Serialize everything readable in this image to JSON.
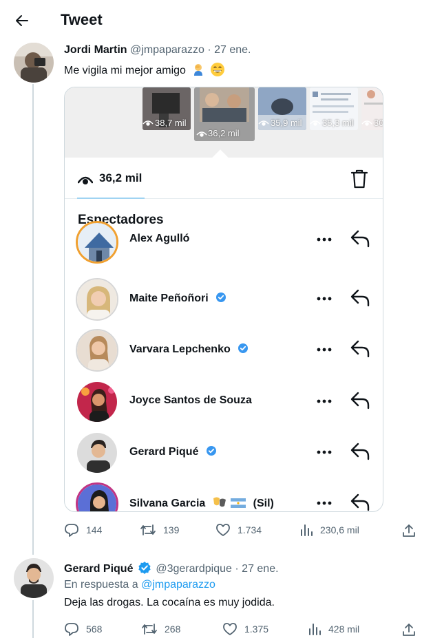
{
  "header": {
    "title": "Tweet"
  },
  "tweet": {
    "author_name": "Jordi Martin",
    "author_handle": "@jmpaparazzo",
    "date": "· 27 ene.",
    "text": "Me vigila mi mejor amigo",
    "emojis": [
      "man-facepalming-emoji",
      "grinning-face-emoji"
    ],
    "media": {
      "thumbnails": [
        {
          "views": "38,7 mil"
        },
        {
          "views": "36,2 mil"
        },
        {
          "views": "35,9 mil"
        },
        {
          "views": "35,3 mil"
        },
        {
          "views": "30"
        }
      ],
      "selected_views": "36,2 mil",
      "viewers_heading": "Espectadores",
      "viewers": [
        {
          "name": "Alex Agulló",
          "verified": false
        },
        {
          "name": "Maite Peñoñori",
          "verified": true
        },
        {
          "name": "Varvara Lepchenko",
          "verified": true
        },
        {
          "name": "Joyce Santos de Souza",
          "verified": false
        },
        {
          "name": "Gerard Piqué",
          "verified": true
        },
        {
          "name": "Silvana Garcia",
          "suffix": "(Sil)",
          "verified": false
        }
      ]
    },
    "stats": {
      "replies": "144",
      "retweets": "139",
      "likes": "1.734",
      "views": "230,6 mil"
    }
  },
  "reply": {
    "author_name": "Gerard Piqué",
    "author_handle": "@3gerardpique",
    "date": "· 27 ene.",
    "in_reply_prefix": "En respuesta a",
    "in_reply_handle": "@jmpaparazzo",
    "text": "Deja las drogas. La cocaína es muy jodida.",
    "stats": {
      "replies": "568",
      "retweets": "268",
      "likes": "1.375",
      "views": "428 mil"
    }
  },
  "colors": {
    "accent": "#1d9bf0",
    "secondary_text": "#536471",
    "border": "#cfd9de"
  }
}
